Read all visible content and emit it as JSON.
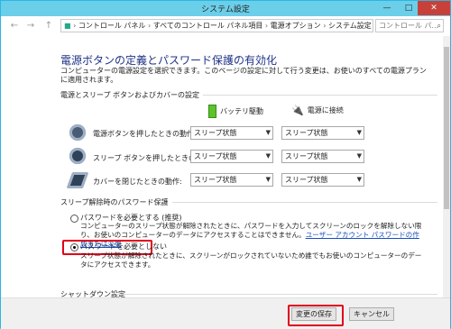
{
  "window": {
    "title": "システム設定",
    "minimize": "—",
    "maximize": "□",
    "close": "✕"
  },
  "nav": {
    "back_icon": "←",
    "forward_icon": "→",
    "up_icon": "↑",
    "breadcrumb": [
      "コントロール パネル",
      "すべてのコントロール パネル項目",
      "電源オプション",
      "システム設定"
    ],
    "sep": "›",
    "search_placeholder": "コントロール パ...",
    "search_icon": "⌕"
  },
  "page": {
    "heading": "電源ボタンの定義とパスワード保護の有効化",
    "description": "コンピューターの電源設定を選択できます。このページの設定に対して行う変更は、お使いのすべての電源プランに適用されます。"
  },
  "power": {
    "section_title": "電源とスリープ ボタンおよびカバーの設定",
    "col_battery": "バッテリ駆動",
    "col_plugged": "電源に接続",
    "rows": [
      {
        "label": "電源ボタンを押したときの動作:",
        "battery": "スリープ状態",
        "plugged": "スリープ状態"
      },
      {
        "label": "スリープ ボタンを押したときの動作:",
        "battery": "スリープ状態",
        "plugged": "スリープ状態"
      },
      {
        "label": "カバーを閉じたときの動作:",
        "battery": "スリープ状態",
        "plugged": "スリープ状態"
      }
    ]
  },
  "password": {
    "section_title": "スリープ解除時のパスワード保護",
    "option_require": "パスワードを必要とする (推奨)",
    "require_desc": "コンピューターのスリープ状態が解除されたときに、パスワードを入力してスクリーンのロックを解除しない限り、お使いのコンピューターのデータにアクセスすることはできません。",
    "link": "ユーザー アカウント パスワードの作成または変更",
    "option_norequire": "パスワードを必要としない",
    "norequire_desc": "スリープ状態が解除されたときに、スクリーンがロックされていないため誰でもお使いのコンピューターのデータにアクセスできます。"
  },
  "shutdown": {
    "section_title": "シャットダウン設定"
  },
  "footer": {
    "save": "変更の保存",
    "cancel": "キャンセル"
  },
  "colors": {
    "titlebar": "#6ccfe9",
    "heading": "#1e3287",
    "highlight": "#e0001b"
  }
}
